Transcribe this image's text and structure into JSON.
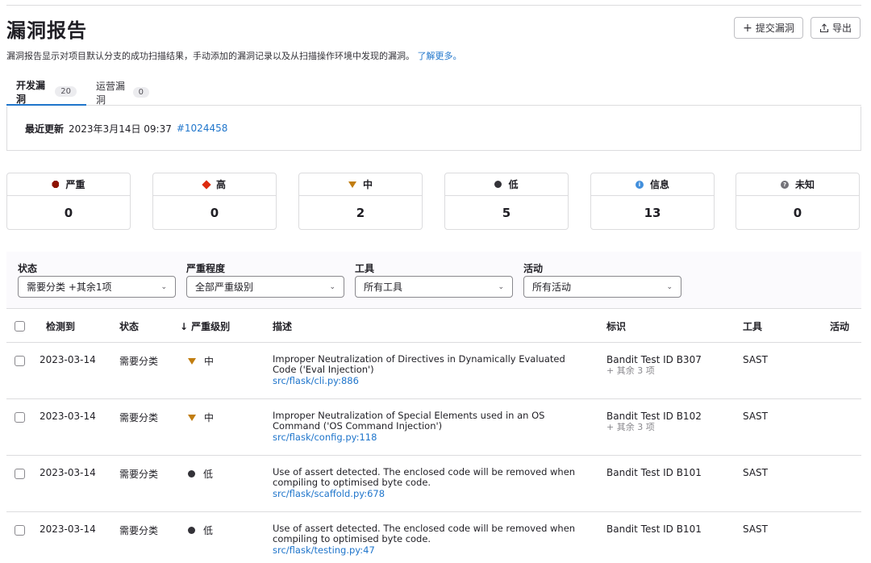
{
  "header": {
    "title": "漏洞报告",
    "submit_label": "提交漏洞",
    "export_label": "导出",
    "description": "漏洞报告显示对项目默认分支的成功扫描结果，手动添加的漏洞记录以及从扫描操作环境中发现的漏洞。",
    "learn_more": "了解更多。"
  },
  "tabs": [
    {
      "label": "开发漏洞",
      "count": "20"
    },
    {
      "label": "运营漏洞",
      "count": "0"
    }
  ],
  "last_updated": {
    "label": "最近更新",
    "time": "2023年3月14日 09:37",
    "pipeline": "#1024458"
  },
  "severity_counts": [
    {
      "label": "严重",
      "value": "0",
      "icon": "critical-icon",
      "color": "#8d1300"
    },
    {
      "label": "高",
      "value": "0",
      "icon": "high-icon",
      "color": "#dd2b0e"
    },
    {
      "label": "中",
      "value": "2",
      "icon": "medium-icon",
      "color": "#c17d10"
    },
    {
      "label": "低",
      "value": "5",
      "icon": "low-icon",
      "color": "#333238"
    },
    {
      "label": "信息",
      "value": "13",
      "icon": "info-icon",
      "color": "#428fdc"
    },
    {
      "label": "未知",
      "value": "0",
      "icon": "unknown-icon",
      "color": "#737278"
    }
  ],
  "filters": [
    {
      "label": "状态",
      "value": "需要分类 +其余1项"
    },
    {
      "label": "严重程度",
      "value": "全部严重级别"
    },
    {
      "label": "工具",
      "value": "所有工具"
    },
    {
      "label": "活动",
      "value": "所有活动"
    }
  ],
  "table": {
    "headers": {
      "detected": "检测到",
      "status": "状态",
      "severity": "严重级别",
      "severity_sort": "↓",
      "description": "描述",
      "identifier": "标识",
      "tool": "工具",
      "activity": "活动"
    },
    "rows": [
      {
        "detected": "2023-03-14",
        "status": "需要分类",
        "severity": "中",
        "severity_icon": "medium-icon",
        "description": "Improper Neutralization of Directives in Dynamically Evaluated Code ('Eval Injection')",
        "file": "src/flask/cli.py:886",
        "identifier": "Bandit Test ID B307",
        "identifier_more": "+ 其余 3 项",
        "tool": "SAST"
      },
      {
        "detected": "2023-03-14",
        "status": "需要分类",
        "severity": "中",
        "severity_icon": "medium-icon",
        "description": "Improper Neutralization of Special Elements used in an OS Command ('OS Command Injection')",
        "file": "src/flask/config.py:118",
        "identifier": "Bandit Test ID B102",
        "identifier_more": "+ 其余 3 项",
        "tool": "SAST"
      },
      {
        "detected": "2023-03-14",
        "status": "需要分类",
        "severity": "低",
        "severity_icon": "low-icon",
        "description": "Use of assert detected. The enclosed code will be removed when compiling to optimised byte code.",
        "file": "src/flask/scaffold.py:678",
        "identifier": "Bandit Test ID B101",
        "identifier_more": "",
        "tool": "SAST"
      },
      {
        "detected": "2023-03-14",
        "status": "需要分类",
        "severity": "低",
        "severity_icon": "low-icon",
        "description": "Use of assert detected. The enclosed code will be removed when compiling to optimised byte code.",
        "file": "src/flask/testing.py:47",
        "identifier": "Bandit Test ID B101",
        "identifier_more": "",
        "tool": "SAST"
      }
    ]
  }
}
